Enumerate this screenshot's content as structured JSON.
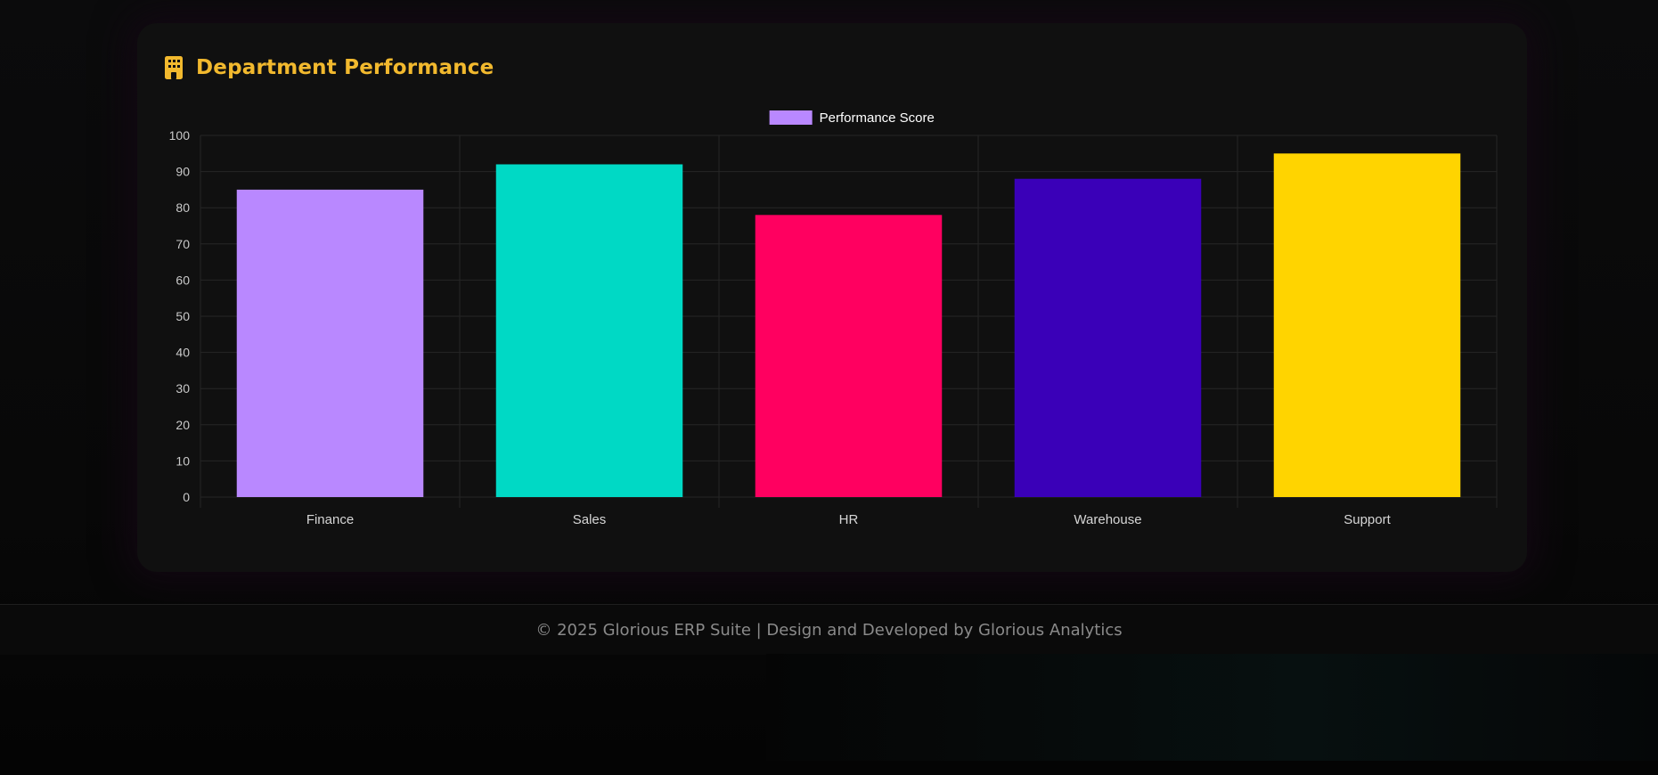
{
  "card": {
    "title": "Department Performance",
    "icon": "building-icon",
    "accent_color": "#f2b92e"
  },
  "chart_data": {
    "type": "bar",
    "categories": [
      "Finance",
      "Sales",
      "HR",
      "Warehouse",
      "Support"
    ],
    "series": [
      {
        "name": "Performance Score",
        "values": [
          85,
          92,
          78,
          88,
          95
        ],
        "colors": [
          "#b988ff",
          "#00d9c5",
          "#ff0060",
          "#3a00b8",
          "#ffd400"
        ]
      }
    ],
    "legend_color": "#b988ff",
    "legend_position": "top-center",
    "ylim": [
      0,
      100
    ],
    "yticks": [
      0,
      10,
      20,
      30,
      40,
      50,
      60,
      70,
      80,
      90,
      100
    ],
    "grid": true
  },
  "footer": {
    "text": "© 2025 Glorious ERP Suite | Design and Developed by Glorious Analytics"
  }
}
